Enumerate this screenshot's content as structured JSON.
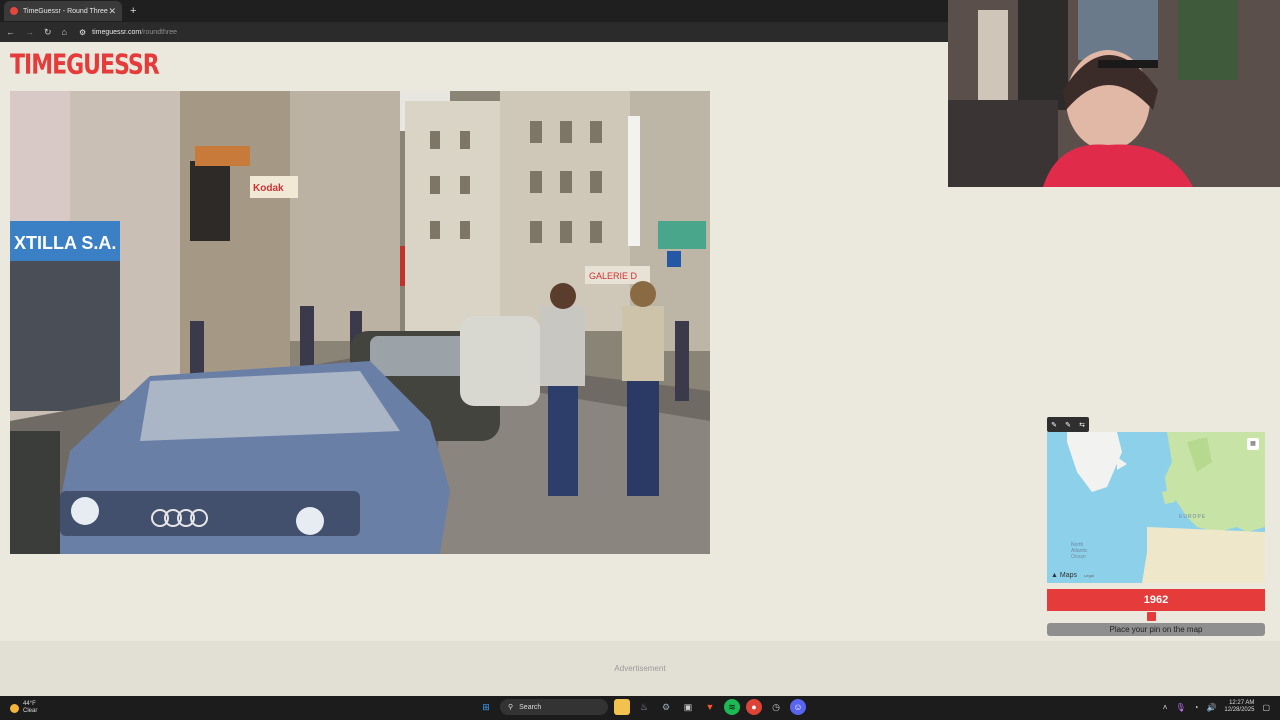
{
  "browser": {
    "tab_title": "TimeGuessr - Round Three",
    "tab_close": "✕",
    "new_tab": "+",
    "url_host": "timeguessr.com",
    "url_path": "/roundthree",
    "nav_back": "←",
    "nav_forward": "→",
    "nav_reload": "↻",
    "nav_home": "⌂"
  },
  "site": {
    "logo": "TIMEGUESSR"
  },
  "map": {
    "tools": [
      "✎",
      "✎",
      "⇆"
    ],
    "label_europe": "EUROPE",
    "label_ocean": "North Atlantic Ocean",
    "maps_brand": "Maps",
    "legal": "Legal"
  },
  "guess": {
    "year": "1962",
    "year_fraction": 0.48,
    "place_pin": "Place your pin on the map"
  },
  "ad": {
    "label": "Advertisement"
  },
  "taskbar": {
    "temp": "44°F",
    "condition": "Clear",
    "search": "Search",
    "time": "12:27 AM",
    "date": "12/28/2025"
  },
  "colors": {
    "accent": "#e53b3b",
    "page_bg": "#ebe9dd",
    "map_water": "#8dd0ea"
  }
}
